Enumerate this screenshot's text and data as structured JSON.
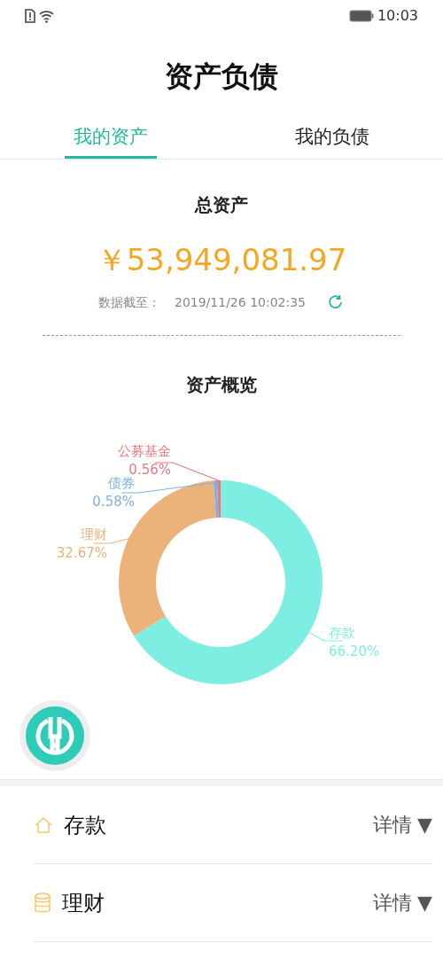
{
  "status_bar": {
    "time": "10:03"
  },
  "title": "资产负债",
  "tabs": [
    {
      "label": "我的资产",
      "selected": true
    },
    {
      "label": "我的负债",
      "selected": false
    }
  ],
  "total": {
    "label": "总资产",
    "amount": "￥53,949,081.97",
    "as_of_label": "数据截至：",
    "as_of": "2019/11/26 10:02:35"
  },
  "overview": {
    "title": "资产概览",
    "chart_data": {
      "type": "donut",
      "categories": [
        "存款",
        "理财",
        "债券",
        "公募基金"
      ],
      "values": [
        66.2,
        32.67,
        0.58,
        0.56
      ],
      "colors": [
        "#7eeee2",
        "#ebb27a",
        "#7fb0e8",
        "#e8797f"
      ],
      "value_labels": [
        "66.20%",
        "32.67%",
        "0.58%",
        "0.56%"
      ]
    }
  },
  "categories": [
    {
      "label": "存款",
      "kind": "deposit",
      "detail": "详情",
      "toggle": "▼"
    },
    {
      "label": "理财",
      "kind": "wealth",
      "detail": "详情",
      "toggle": "▼"
    }
  ]
}
